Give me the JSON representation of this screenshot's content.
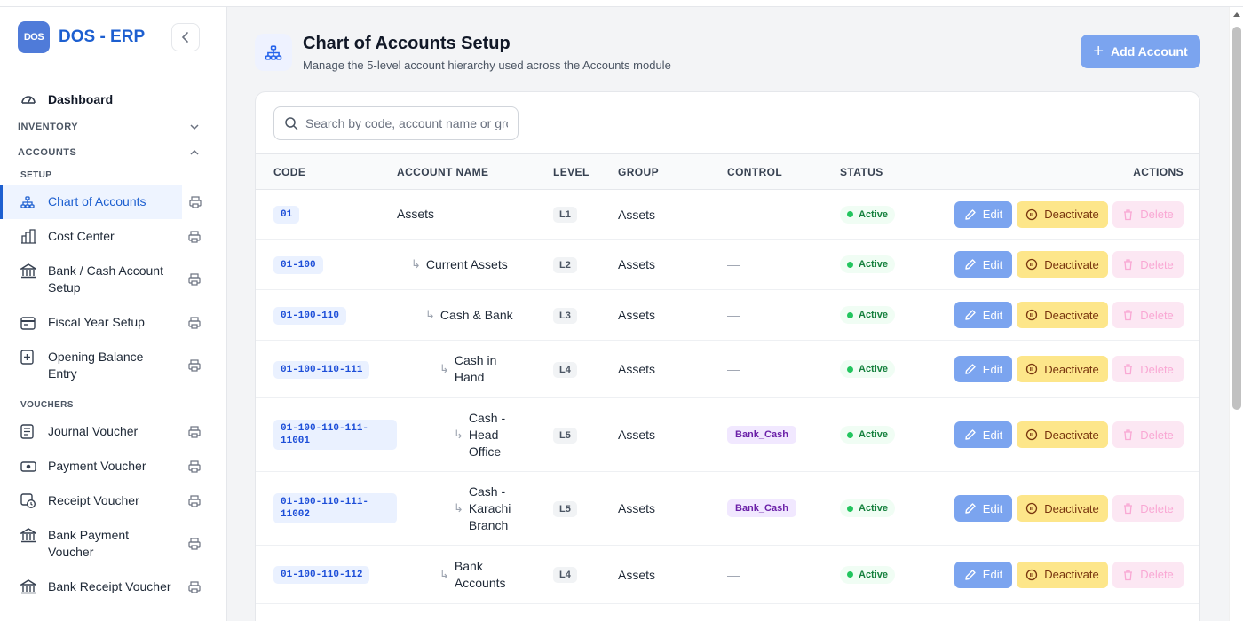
{
  "brand": {
    "logo_text": "DOS",
    "name": "DOS - ERP"
  },
  "sidebar": {
    "dashboard": "Dashboard",
    "sections": {
      "inventory": "INVENTORY",
      "accounts": "ACCOUNTS"
    },
    "groups": {
      "setup": "SETUP",
      "vouchers": "VOUCHERS"
    },
    "setup_items": [
      {
        "label": "Chart of Accounts",
        "icon": "hierarchy-icon"
      },
      {
        "label": "Cost Center",
        "icon": "building-chart-icon"
      },
      {
        "label": "Bank / Cash Account Setup",
        "icon": "bank-icon"
      },
      {
        "label": "Fiscal Year Setup",
        "icon": "calendar-icon"
      },
      {
        "label": "Opening Balance Entry",
        "icon": "plus-box-icon"
      }
    ],
    "voucher_items": [
      {
        "label": "Journal Voucher",
        "icon": "journal-icon"
      },
      {
        "label": "Payment Voucher",
        "icon": "cash-icon"
      },
      {
        "label": "Receipt Voucher",
        "icon": "receipt-icon"
      },
      {
        "label": "Bank Payment Voucher",
        "icon": "bank-icon"
      },
      {
        "label": "Bank Receipt Voucher",
        "icon": "bank-icon"
      }
    ]
  },
  "header": {
    "title": "Chart of Accounts Setup",
    "subtitle": "Manage the 5-level account hierarchy used across the Accounts module",
    "add_button": "Add Account"
  },
  "search": {
    "placeholder": "Search by code, account name or group"
  },
  "table": {
    "columns": {
      "code": "CODE",
      "name": "ACCOUNT NAME",
      "level": "LEVEL",
      "group": "GROUP",
      "control": "CONTROL",
      "status": "STATUS",
      "actions": "ACTIONS"
    },
    "action_labels": {
      "edit": "Edit",
      "deactivate": "Deactivate",
      "delete": "Delete"
    },
    "rows": [
      {
        "code": "01",
        "name": "Assets",
        "level": "L1",
        "group": "Assets",
        "control": "—",
        "status": "Active"
      },
      {
        "code": "01-100",
        "name": "Current Assets",
        "level": "L2",
        "group": "Assets",
        "control": "—",
        "status": "Active"
      },
      {
        "code": "01-100-110",
        "name": "Cash & Bank",
        "level": "L3",
        "group": "Assets",
        "control": "—",
        "status": "Active"
      },
      {
        "code": "01-100-110-111",
        "name": "Cash in Hand",
        "level": "L4",
        "group": "Assets",
        "control": "—",
        "status": "Active"
      },
      {
        "code": "01-100-110-111-11001",
        "name": "Cash - Head Office",
        "level": "L5",
        "group": "Assets",
        "control": "Bank_Cash",
        "status": "Active"
      },
      {
        "code": "01-100-110-111-11002",
        "name": "Cash - Karachi Branch",
        "level": "L5",
        "group": "Assets",
        "control": "Bank_Cash",
        "status": "Active"
      },
      {
        "code": "01-100-110-112",
        "name": "Bank Accounts",
        "level": "L4",
        "group": "Assets",
        "control": "—",
        "status": "Active"
      }
    ]
  },
  "colors": {
    "brand": "#1d5fd0",
    "primary_button": "#7ba4ef",
    "deactivate": "#fde68a",
    "delete": "#fce7f3",
    "active": "#22c55e",
    "control": "#6b21a8"
  }
}
